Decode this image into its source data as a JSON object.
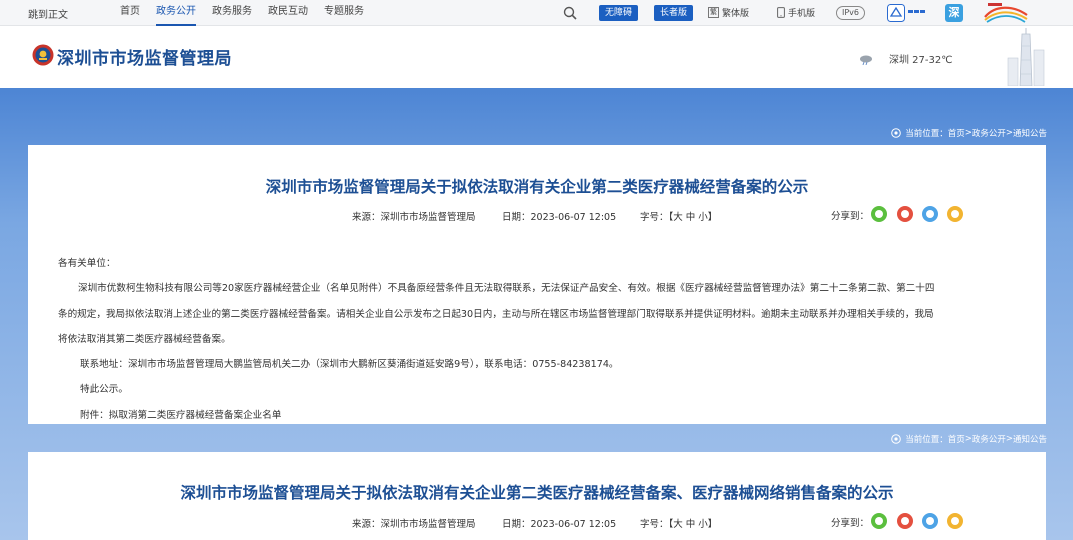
{
  "topbar": {
    "skip": "跳到正文",
    "nav": [
      "首页",
      "政务公开",
      "政务服务",
      "政民互动",
      "专题服务"
    ],
    "active_index": 1,
    "accessible": "无障碍",
    "elder": "长者版",
    "traditional": "繁体版",
    "mobile": "手机版",
    "ipv6": "IPv6",
    "logo2_text": "深"
  },
  "header": {
    "title": "深圳市市场监督管理局",
    "weather": "深圳 27-32℃"
  },
  "breadcrumb": {
    "label": "当前位置：",
    "items": [
      "首页",
      "政务公开",
      "通知公告"
    ],
    "sep": " > "
  },
  "articles": [
    {
      "title": "深圳市市场监督管理局关于拟依法取消有关企业第二类医疗器械经营备案的公示",
      "source": "来源：深圳市市场监督管理局",
      "date": "日期：2023-06-07 12:05",
      "fontsize": "字号：【大 中 小】",
      "share": "分享到：",
      "salutation": "各有关单位：",
      "para1": "深圳市优数柯生物科技有限公司等20家医疗器械经营企业（名单见附件）不具备原经营条件且无法取得联系，无法保证产品安全、有效。根据《医疗器械经营监督管理办法》第二十二条第二款、第二十四条的规定，我局拟依法取消上述企业的第二类医疗器械经营备案。请相关企业自公示发布之日起30日内，主动与所在辖区市场监督管理部门取得联系并提供证明材料。逾期未主动联系并办理相关手续的，我局将依法取消其第二类医疗器械经营备案。",
      "contact": "联系地址：深圳市市场监督管理局大鹏监管局机关二办（深圳市大鹏新区葵涌街道延安路9号），联系电话：0755-84238174。",
      "notice": "特此公示。",
      "attachment": "附件：拟取消第二类医疗器械经营备案企业名单"
    },
    {
      "title": "深圳市市场监督管理局关于拟依法取消有关企业第二类医疗器械经营备案、医疗器械网络销售备案的公示",
      "source": "来源：深圳市市场监督管理局",
      "date": "日期：2023-06-07 12:05",
      "fontsize": "字号：【大 中 小】",
      "share": "分享到："
    }
  ],
  "colors": {
    "brand_blue": "#1d4f94",
    "band_top": "#4d85d4",
    "wechat": "#5bbf3e",
    "weibo": "#e4503f",
    "qq": "#4ea3e6",
    "qzone": "#f2b431"
  },
  "icons": [
    "search-icon",
    "emblem-icon",
    "weather-icon",
    "location-pin-icon",
    "wechat-icon",
    "weibo-icon",
    "qq-icon",
    "qzone-icon"
  ]
}
